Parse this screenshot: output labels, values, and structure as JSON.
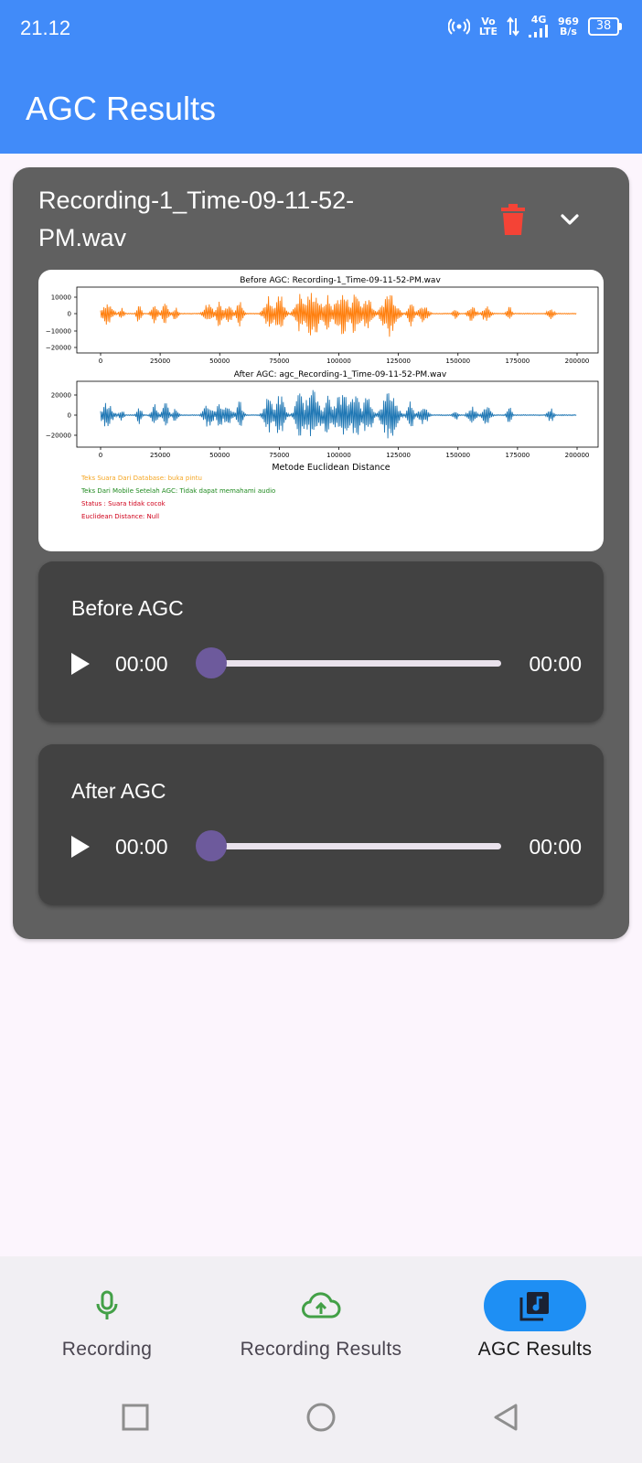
{
  "status_bar": {
    "time": "21.12",
    "volte_top": "Vo",
    "volte_bottom": "LTE",
    "network": "4G",
    "speed_value": "969",
    "speed_unit": "B/s",
    "battery": "38"
  },
  "app_bar": {
    "title": "AGC Results"
  },
  "card": {
    "filename_line1": "Recording-1_Time-09-11-52-",
    "filename_line2": "PM.wav",
    "delete_icon": "trash-icon",
    "expand_icon": "chevron-down-icon",
    "delete_color": "#f44336"
  },
  "plot": {
    "before_title": "Before AGC: Recording-1_Time-09-11-52-PM.wav",
    "after_title": "After AGC: agc_Recording-1_Time-09-11-52-PM.wav",
    "before_yticks": [
      "10000",
      "0",
      "−10000",
      "−20000"
    ],
    "after_yticks": [
      "20000",
      "0",
      "−20000"
    ],
    "xticks": [
      "0",
      "25000",
      "50000",
      "75000",
      "100000",
      "125000",
      "150000",
      "175000",
      "200000"
    ],
    "method_label": "Metode Euclidean Distance",
    "info_lines": [
      {
        "text": "Teks Suara Dari Database: buka pintu",
        "color": "#f5a623"
      },
      {
        "text": "Teks Dari Mobile Setelah AGC: Tidak dapat memahami audio",
        "color": "#1f8a1f"
      },
      {
        "text": "Status : Suara tidak cocok",
        "color": "#d0021b"
      },
      {
        "text": "Euclidean Distance: Null",
        "color": "#d0021b"
      }
    ],
    "before_color": "#ff7f0e",
    "after_color": "#1f77b4"
  },
  "players": [
    {
      "title": "Before AGC",
      "position": "00:00",
      "duration": "00:00",
      "progress": 0
    },
    {
      "title": "After AGC",
      "position": "00:00",
      "duration": "00:00",
      "progress": 0
    }
  ],
  "bottom_nav": {
    "items": [
      {
        "label": "Recording",
        "icon": "mic-icon",
        "active": false
      },
      {
        "label": "Recording Results",
        "icon": "cloud-upload-icon",
        "active": false
      },
      {
        "label": "AGC Results",
        "icon": "music-library-icon",
        "active": true
      }
    ]
  },
  "system_nav": {
    "icons": [
      "recents-square-icon",
      "home-circle-icon",
      "back-triangle-icon"
    ]
  }
}
